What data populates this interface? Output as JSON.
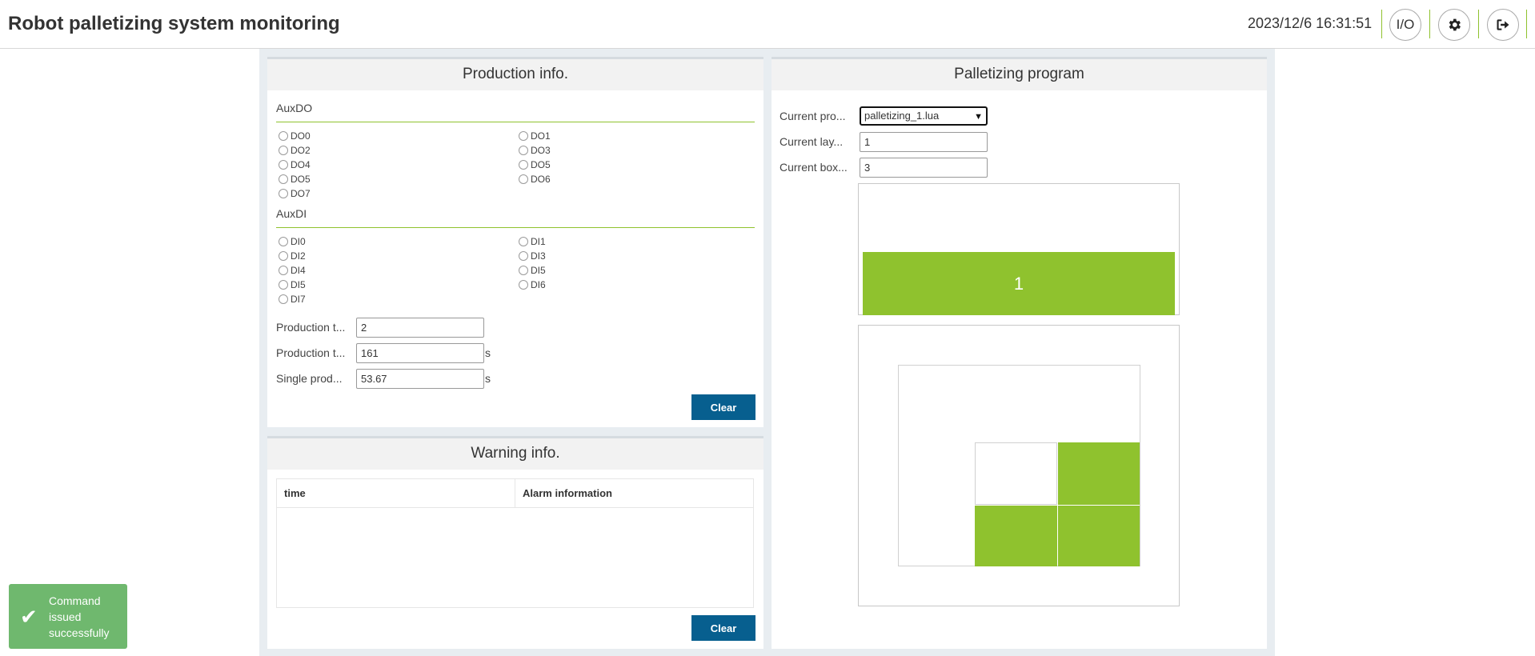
{
  "header": {
    "title": "Robot palletizing system monitoring",
    "datetime": "2023/12/6 16:31:51",
    "io_label": "I/O",
    "icons": {
      "settings": "gear-icon",
      "logout": "logout-icon"
    }
  },
  "production": {
    "title": "Production info.",
    "auxdo": {
      "title": "AuxDO",
      "items": [
        "DO0",
        "DO1",
        "DO2",
        "DO3",
        "DO4",
        "DO5",
        "DO5",
        "DO6",
        "DO7"
      ]
    },
    "auxdi": {
      "title": "AuxDI",
      "items": [
        "DI0",
        "DI1",
        "DI2",
        "DI3",
        "DI4",
        "DI5",
        "DI5",
        "DI6",
        "DI7"
      ]
    },
    "fields": [
      {
        "label": "Production t...",
        "value": "2",
        "unit": ""
      },
      {
        "label": "Production t...",
        "value": "161",
        "unit": "s"
      },
      {
        "label": "Single prod...",
        "value": "53.67",
        "unit": "s"
      }
    ],
    "clear_label": "Clear"
  },
  "warning": {
    "title": "Warning info.",
    "columns": [
      "time",
      "Alarm information"
    ],
    "rows": [],
    "clear_label": "Clear"
  },
  "palletizing": {
    "title": "Palletizing program",
    "program_label": "Current pro...",
    "program_value": "palletizing_1.lua",
    "layer_label": "Current lay...",
    "layer_value": "1",
    "box_label": "Current box...",
    "box_value": "3",
    "layers": [
      "1"
    ],
    "boxes_filled": 3
  },
  "toast": {
    "message": "Command issued successfully",
    "icon": "check-icon",
    "color": "#6fb86e"
  },
  "colors": {
    "accent": "#8fc22e",
    "button": "#075f8f"
  }
}
